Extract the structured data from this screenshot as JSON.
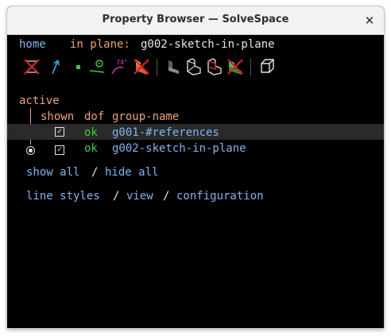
{
  "window": {
    "title": "Property Browser — SolveSpace",
    "close_glyph": "✕"
  },
  "nav": {
    "home": "home",
    "in_plane_label": "in plane:",
    "group_name": "g002-sketch-in-plane"
  },
  "toolbar": {
    "icons": [
      "workplane-hidden-icon",
      "normal-arrow-icon",
      "point-icon",
      "constraint-icon",
      "dimension-icon",
      "surface-hidden-icon",
      "solid-shaded-icon",
      "edges-icon",
      "outline-icon",
      "mesh-icon",
      "perspective-cube-icon"
    ]
  },
  "groups": {
    "active_label": "active",
    "headers": {
      "shown": "shown",
      "dof": "dof",
      "name": "group-name"
    },
    "rows": [
      {
        "shown": true,
        "dof": "ok",
        "name": "g001-#references",
        "active": false
      },
      {
        "shown": true,
        "dof": "ok",
        "name": "g002-sketch-in-plane",
        "active": true
      }
    ]
  },
  "links": {
    "show_all": "show all",
    "hide_all": "hide all",
    "line_styles": "line styles",
    "view": "view",
    "configuration": "configuration",
    "sep": "/"
  },
  "colors": {
    "link": "#7fb4f0",
    "accent": "#f0a26d",
    "ok": "#31d331",
    "background": "#000000"
  }
}
